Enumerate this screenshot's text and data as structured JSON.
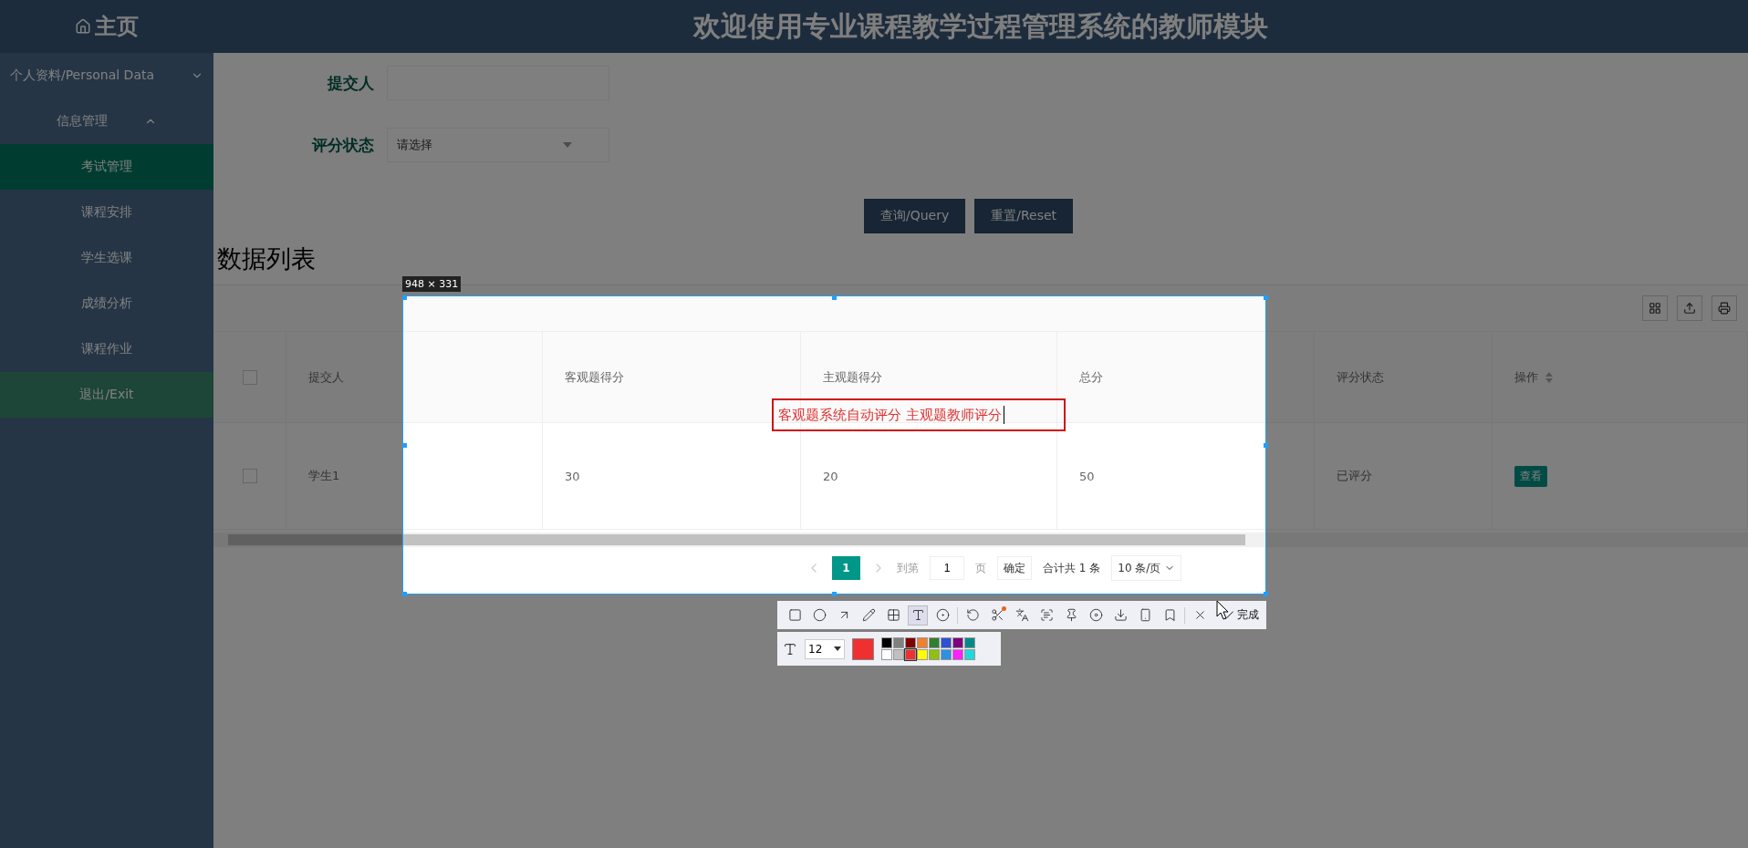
{
  "header": {
    "home": "主页",
    "title": "欢迎使用专业课程教学过程管理系统的教师模块"
  },
  "sidebar": {
    "items": [
      {
        "label": "个人资料/Personal Data",
        "kind": "group",
        "expanded": false
      },
      {
        "label": "信息管理",
        "kind": "group",
        "expanded": true,
        "children": [
          {
            "label": "考试管理",
            "selected": true
          },
          {
            "label": "课程安排",
            "selected": false
          },
          {
            "label": "学生选课",
            "selected": false
          },
          {
            "label": "成绩分析",
            "selected": false
          },
          {
            "label": "课程作业",
            "selected": false
          }
        ]
      },
      {
        "label": "退出/Exit",
        "kind": "exit"
      }
    ]
  },
  "search_form": {
    "fields": [
      {
        "label": "提交人",
        "kind": "text"
      },
      {
        "label": "评分状态",
        "kind": "select",
        "placeholder": "请选择"
      }
    ],
    "buttons": [
      "查询/Query",
      "重置/Reset"
    ]
  },
  "list_title": "数据列表",
  "table": {
    "select_all_checked": false,
    "columns": [
      {
        "label": "提交人",
        "sortable": false
      },
      {
        "label": "客观题得分",
        "sortable": false
      },
      {
        "label": "主观题得分",
        "sortable": false
      },
      {
        "label": "总分",
        "sortable": false
      },
      {
        "label": "评分状态",
        "sortable": false
      },
      {
        "label": "操作",
        "sortable": true
      }
    ],
    "rows": [
      {
        "checked": false,
        "cells": [
          "学生1",
          "30",
          "20",
          "50",
          "已评分"
        ],
        "action": "查看"
      }
    ]
  },
  "pagination": {
    "pages": [
      {
        "label": "1",
        "selected": true
      }
    ],
    "goto_label": "到第",
    "goto_value": "1",
    "page_unit": "页",
    "confirm": "确定",
    "total": "合计共 1 条",
    "page_size": "10 条/页"
  },
  "capture": {
    "size_label": "948 × 331",
    "annotation": "客观题系统自动评分 主观题教师评分",
    "done_label": "完成",
    "font_size": "12",
    "tools": [
      {
        "kind": "rectangle",
        "selected": false
      },
      {
        "kind": "ellipse",
        "selected": false
      },
      {
        "kind": "arrow",
        "selected": false
      },
      {
        "kind": "pen",
        "selected": false
      },
      {
        "kind": "mosaic",
        "selected": false
      },
      {
        "kind": "text",
        "selected": true
      },
      {
        "kind": "number",
        "selected": false
      },
      {
        "kind": "sep"
      },
      {
        "kind": "undo",
        "selected": false
      },
      {
        "kind": "cut",
        "selected": false
      },
      {
        "kind": "translate",
        "selected": false
      },
      {
        "kind": "ocr",
        "selected": false
      },
      {
        "kind": "pin",
        "selected": false
      },
      {
        "kind": "record",
        "selected": false
      },
      {
        "kind": "save",
        "selected": false
      },
      {
        "kind": "phone",
        "selected": false
      },
      {
        "kind": "bookmark",
        "selected": false
      },
      {
        "kind": "sep"
      },
      {
        "kind": "close",
        "selected": false
      }
    ],
    "colors": [
      {
        "color": "#000000"
      },
      {
        "color": "#808080"
      },
      {
        "color": "#800000"
      },
      {
        "color": "#f08030"
      },
      {
        "color": "#308030"
      },
      {
        "color": "#3050d0"
      },
      {
        "color": "#800080"
      },
      {
        "color": "#008b8b"
      },
      {
        "color": "#ffffff"
      },
      {
        "color": "#c0c0c0"
      },
      {
        "color": "#f03030",
        "selected": true
      },
      {
        "color": "#ffff00"
      },
      {
        "color": "#90c010"
      },
      {
        "color": "#3090e0"
      },
      {
        "color": "#ff20ff"
      },
      {
        "color": "#20d8d8"
      }
    ]
  }
}
